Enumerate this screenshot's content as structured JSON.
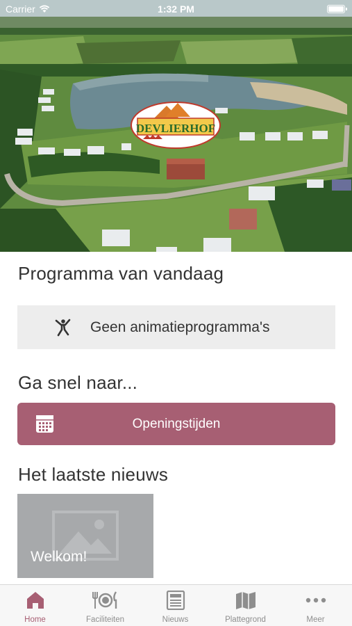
{
  "status_bar": {
    "carrier": "Carrier",
    "time": "1:32 PM"
  },
  "hero": {
    "logo_text": "DEVLIERHOF"
  },
  "today": {
    "title": "Programma van vandaag",
    "empty_label": "Geen animatieprogramma's"
  },
  "quick_links": {
    "title": "Ga snel naar...",
    "button_label": "Openingstijden"
  },
  "news": {
    "title": "Het laatste nieuws",
    "items": [
      {
        "title": "Welkom!"
      }
    ]
  },
  "tab_bar": {
    "active": "Home",
    "tabs": [
      {
        "label": "Home",
        "icon": "home-icon"
      },
      {
        "label": "Faciliteiten",
        "icon": "cutlery-icon"
      },
      {
        "label": "Nieuws",
        "icon": "newspaper-icon"
      },
      {
        "label": "Plattegrond",
        "icon": "map-icon"
      },
      {
        "label": "Meer",
        "icon": "more-icon"
      }
    ]
  },
  "colors": {
    "accent": "#a75f73",
    "card_bg": "#ededed",
    "tab_inactive": "#8e8e8e"
  }
}
